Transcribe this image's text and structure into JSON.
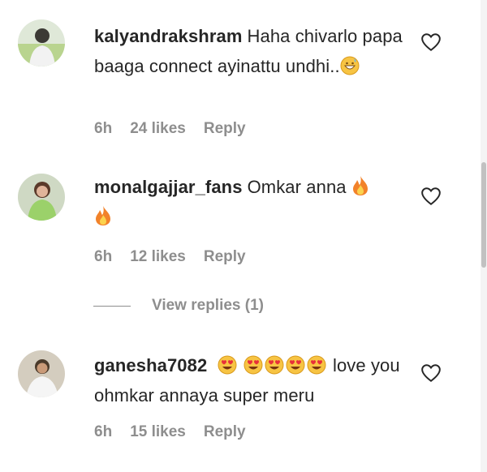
{
  "comments": [
    {
      "username": "kalyandrakshram",
      "text": "Haha chivarlo papa baaga connect ayinattu undhi..",
      "emoji": "grinning-face-sweat",
      "time": "6h",
      "likes": "24 likes",
      "reply": "Reply"
    },
    {
      "username": "monalgajjar_fans",
      "text": "Omkar anna",
      "emoji": "fire",
      "time": "6h",
      "likes": "12 likes",
      "reply": "Reply"
    },
    {
      "username": "ganesha7082",
      "text_after": "love you ohmkar annaya super meru",
      "emoji": "heart-eyes",
      "time": "6h",
      "likes": "15 likes",
      "reply": "Reply"
    }
  ],
  "view_replies": "View replies (1)",
  "colors": {
    "text": "#262626",
    "meta": "#8e8e8e",
    "background": "#ffffff"
  }
}
